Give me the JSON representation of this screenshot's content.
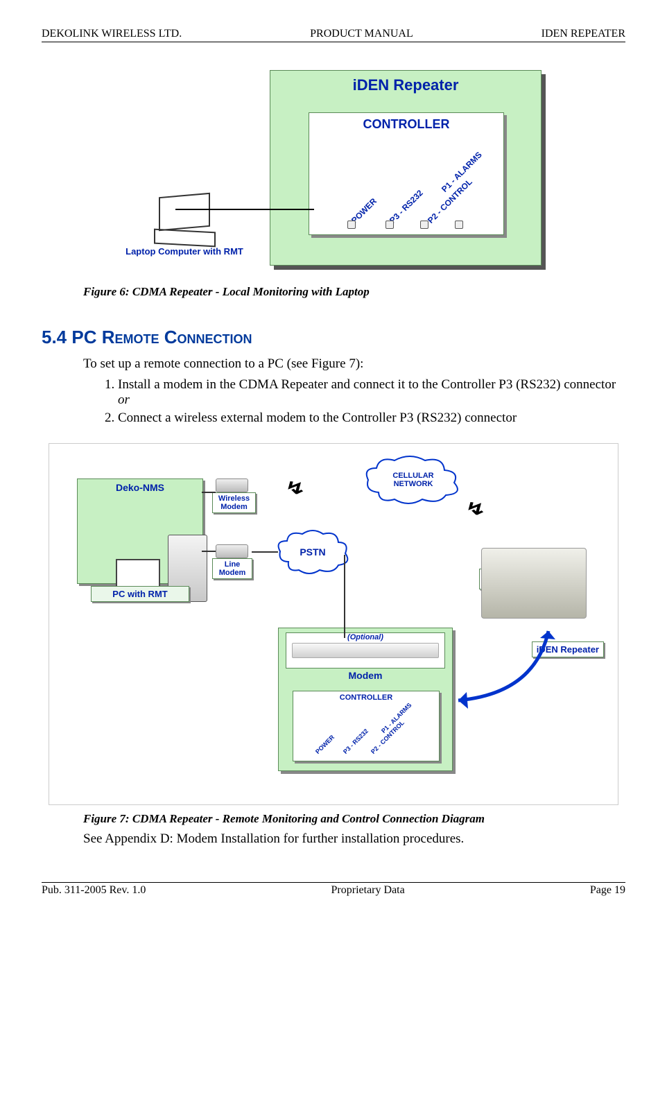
{
  "header": {
    "left": "DEKOLINK WIRELESS LTD.",
    "center": "PRODUCT MANUAL",
    "right": "IDEN REPEATER"
  },
  "figure6": {
    "repeater_title": "iDEN  Repeater",
    "controller_label": "CONTROLLER",
    "ports": {
      "power": "POWER",
      "p3": "P3 - RS232",
      "p2": "P2 - CONTROL",
      "p1": "P1 - ALARMS"
    },
    "laptop_caption": "Laptop Computer with RMT",
    "caption": "Figure 6: CDMA Repeater - Local Monitoring with Laptop"
  },
  "section": {
    "heading": "5.4 PC Remote Connection",
    "intro": "To set up a remote connection to a PC (see Figure 7):",
    "item1_a": "Install a modem in the CDMA Repeater and connect it to the Controller P3 (RS232) connector ",
    "item1_or": "or",
    "item2": "Connect a wireless external modem to the Controller P3 (RS232) connector"
  },
  "figure7": {
    "deko_nms": "Deko-NMS",
    "pc_with_rmt": "PC with RMT",
    "wireless_modem": "Wireless Modem",
    "line_modem": "Line Modem",
    "pstn": "PSTN",
    "cellular": "CELLULAR NETWORK",
    "optional": "(Optional)",
    "modem": "Modem",
    "controller_label": "CONTROLLER",
    "ports": {
      "power": "POWER",
      "p3": "P3 - RS232",
      "p2": "P2 - CONTROL",
      "p1": "P1 - ALARMS"
    },
    "iden_repeater": "iDEN Repeater",
    "caption": "Figure 7: CDMA Repeater - Remote Monitoring and Control Connection Diagram",
    "appendix": "See Appendix D: Modem Installation for further installation procedures."
  },
  "footer": {
    "left": "Pub. 311-2005 Rev. 1.0",
    "center": "Proprietary Data",
    "right": "Page 19"
  }
}
